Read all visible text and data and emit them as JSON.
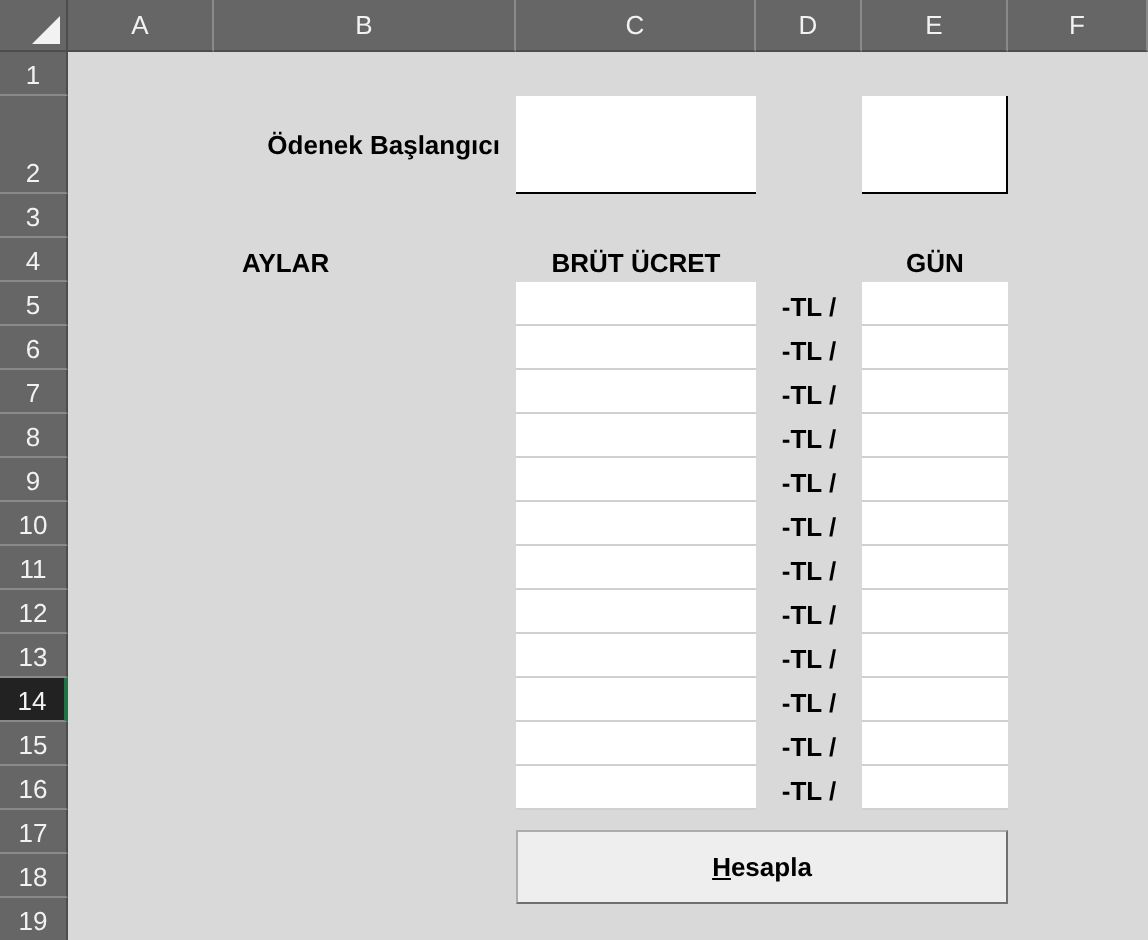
{
  "column_headers": [
    {
      "label": "A"
    },
    {
      "label": "B"
    },
    {
      "label": "C"
    },
    {
      "label": "D"
    },
    {
      "label": "E"
    },
    {
      "label": "F"
    }
  ],
  "row_headers": [
    {
      "label": "1",
      "selected": false
    },
    {
      "label": "2",
      "selected": false
    },
    {
      "label": "3",
      "selected": false
    },
    {
      "label": "4",
      "selected": false
    },
    {
      "label": "5",
      "selected": false
    },
    {
      "label": "6",
      "selected": false
    },
    {
      "label": "7",
      "selected": false
    },
    {
      "label": "8",
      "selected": false
    },
    {
      "label": "9",
      "selected": false
    },
    {
      "label": "10",
      "selected": false
    },
    {
      "label": "11",
      "selected": false
    },
    {
      "label": "12",
      "selected": false
    },
    {
      "label": "13",
      "selected": false
    },
    {
      "label": "14",
      "selected": true
    },
    {
      "label": "15",
      "selected": false
    },
    {
      "label": "16",
      "selected": false
    },
    {
      "label": "17",
      "selected": false
    },
    {
      "label": "18",
      "selected": false
    },
    {
      "label": "19",
      "selected": false
    }
  ],
  "start_label": "Ödenek Başlangıcı",
  "months_label": "AYLAR",
  "gross_label": "BRÜT ÜCRET",
  "day_label": "GÜN",
  "rate_rows": [
    {
      "unit": "-TL /"
    },
    {
      "unit": "-TL /"
    },
    {
      "unit": "-TL /"
    },
    {
      "unit": "-TL /"
    },
    {
      "unit": "-TL /"
    },
    {
      "unit": "-TL /"
    },
    {
      "unit": "-TL /"
    },
    {
      "unit": "-TL /"
    },
    {
      "unit": "-TL /"
    },
    {
      "unit": "-TL /"
    },
    {
      "unit": "-TL /"
    },
    {
      "unit": "-TL /"
    }
  ],
  "button": {
    "label": "Hesapla",
    "access_key_underlined": true
  }
}
